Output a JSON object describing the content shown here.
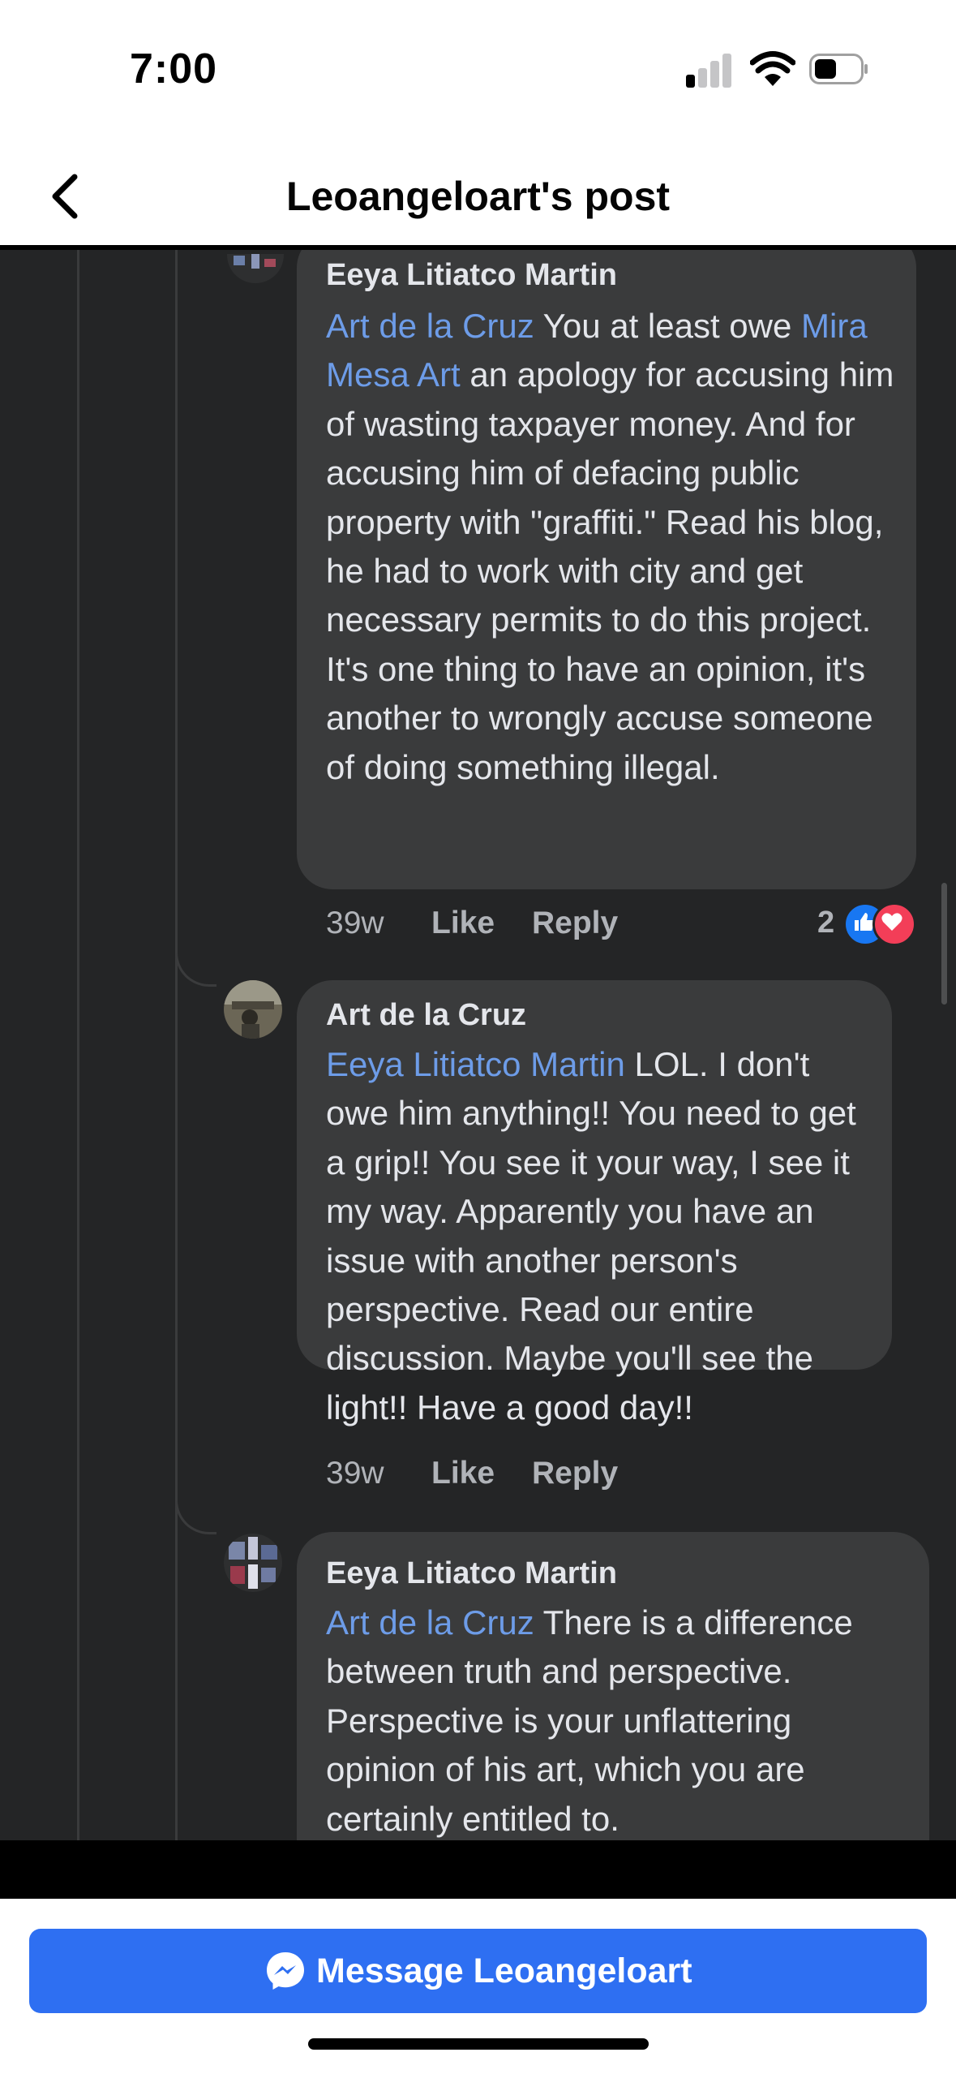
{
  "status_bar": {
    "time": "7:00"
  },
  "nav": {
    "title": "Leoangeloart's post"
  },
  "comments": [
    {
      "author": "Eeya Litiatco Martin",
      "segments": [
        {
          "text": "Art de la Cruz",
          "mention": true
        },
        {
          "text": " You at least owe ",
          "mention": false
        },
        {
          "text": "Mira Mesa Art",
          "mention": true
        },
        {
          "text": " an apology for accusing him of wasting taxpayer money. And for accusing him of defacing public property with \"graffiti.\" Read his blog, he had to work with city and get necessary permits to do this project. It's one thing to have an opinion, it's another to wrongly accuse someone of doing something illegal.",
          "mention": false
        }
      ],
      "time_ago": "39w",
      "like_label": "Like",
      "reply_label": "Reply",
      "reaction_count": "2",
      "reactions": [
        "like-icon",
        "love-icon"
      ]
    },
    {
      "author": "Art de la Cruz",
      "segments": [
        {
          "text": "Eeya Litiatco Martin",
          "mention": true
        },
        {
          "text": " LOL. I don't owe him anything!! You need to get a grip!! You see it your way, I see it my way. Apparently you have an issue with another person's perspective. Read our entire discussion. Maybe you'll see the light!! Have a good day!!",
          "mention": false
        }
      ],
      "time_ago": "39w",
      "like_label": "Like",
      "reply_label": "Reply"
    },
    {
      "author": "Eeya Litiatco Martin",
      "segments": [
        {
          "text": "Art de la Cruz",
          "mention": true
        },
        {
          "text": " There is a difference between truth and perspective. Perspective is your unflattering opinion of his art, which you are certainly entitled to.",
          "mention": false
        }
      ]
    }
  ],
  "footer": {
    "button_label": "Message Leoangeloart",
    "button_icon": "messenger-icon"
  },
  "colors": {
    "mention": "#6d9ce8",
    "bubble": "#3a3b3c",
    "background": "#242526",
    "button": "#2e6ff2"
  }
}
